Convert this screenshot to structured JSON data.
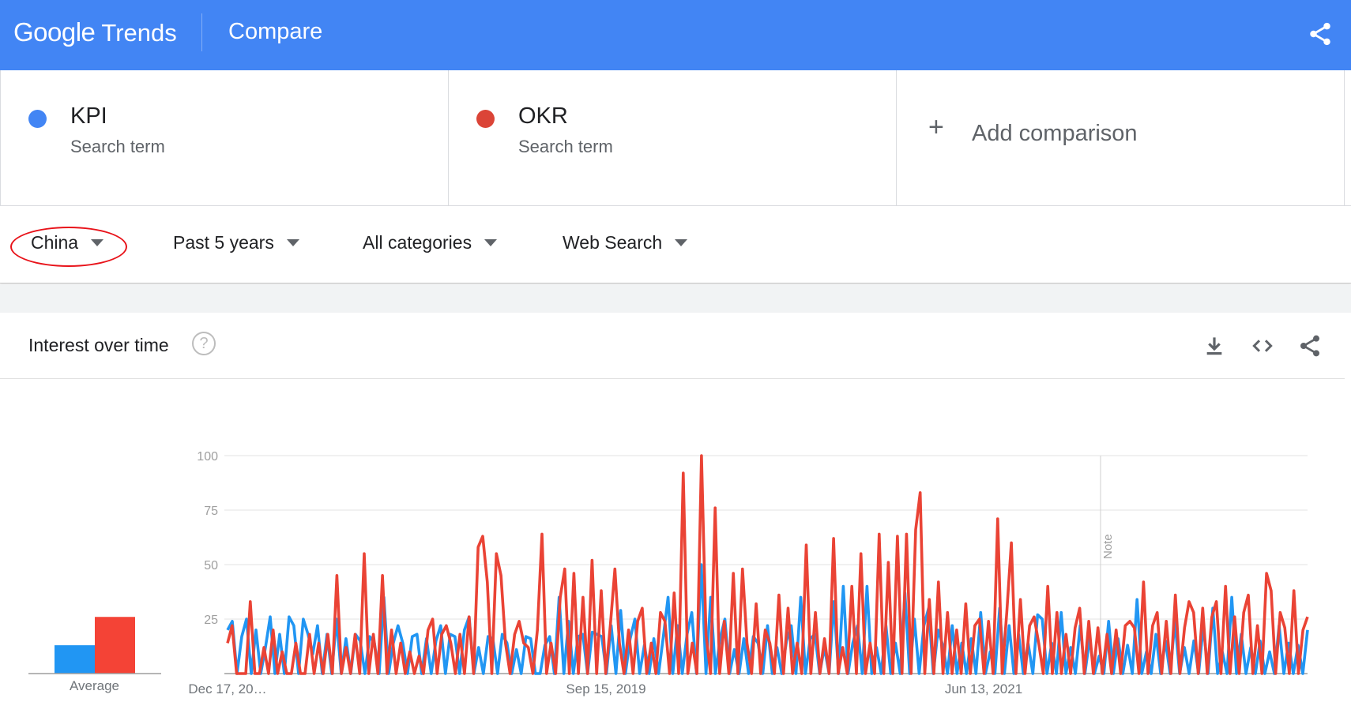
{
  "header": {
    "logo_google": "Google",
    "logo_trends": "Trends",
    "title": "Compare"
  },
  "compare": {
    "terms": [
      {
        "label": "KPI",
        "sub": "Search term",
        "color": "#4285f4"
      },
      {
        "label": "OKR",
        "sub": "Search term",
        "color": "#db4437"
      }
    ],
    "add_label": "Add comparison"
  },
  "filters": {
    "region": "China",
    "time": "Past 5 years",
    "category": "All categories",
    "search_type": "Web Search"
  },
  "widget": {
    "title": "Interest over time",
    "help": "?",
    "average_label": "Average",
    "note_label": "Note"
  },
  "chart_data": {
    "type": "line",
    "x_tick_labels": [
      "Dec 17, 20…",
      "Sep 15, 2019",
      "Jun 13, 2021"
    ],
    "ylim": [
      0,
      100
    ],
    "y_ticks": [
      25,
      50,
      75,
      100
    ],
    "grid": true,
    "averages": [
      {
        "series": "KPI",
        "value": 13
      },
      {
        "series": "OKR",
        "value": 26
      }
    ],
    "series": [
      {
        "name": "KPI",
        "color": "#2196f3",
        "values": [
          20,
          24,
          0,
          17,
          25,
          0,
          20,
          0,
          12,
          26,
          0,
          18,
          0,
          26,
          22,
          0,
          25,
          18,
          9,
          22,
          0,
          18,
          0,
          25,
          0,
          16,
          0,
          18,
          15,
          0,
          17,
          14,
          0,
          35,
          0,
          14,
          22,
          14,
          0,
          17,
          18,
          0,
          16,
          0,
          15,
          22,
          0,
          18,
          17,
          0,
          20,
          26,
          0,
          12,
          0,
          17,
          16,
          0,
          18,
          14,
          0,
          11,
          0,
          17,
          16,
          0,
          0,
          13,
          17,
          0,
          35,
          0,
          24,
          0,
          17,
          18,
          0,
          19,
          18,
          17,
          0,
          22,
          0,
          29,
          0,
          16,
          25,
          0,
          13,
          0,
          16,
          0,
          17,
          35,
          0,
          22,
          0,
          18,
          28,
          0,
          50,
          0,
          35,
          0,
          16,
          25,
          0,
          11,
          0,
          16,
          0,
          17,
          14,
          0,
          22,
          0,
          12,
          0,
          15,
          22,
          0,
          35,
          0,
          16,
          18,
          0,
          12,
          0,
          33,
          0,
          40,
          0,
          14,
          22,
          0,
          40,
          0,
          12,
          0,
          22,
          0,
          14,
          0,
          37,
          0,
          25,
          0,
          22,
          30,
          0,
          20,
          13,
          0,
          22,
          0,
          14,
          0,
          16,
          0,
          28,
          0,
          10,
          0,
          30,
          0,
          22,
          0,
          18,
          0,
          14,
          0,
          27,
          25,
          0,
          14,
          0,
          28,
          0,
          12,
          0,
          22,
          0,
          16,
          0,
          8,
          0,
          24,
          0,
          16,
          0,
          13,
          0,
          34,
          0,
          10,
          0,
          18,
          0,
          15,
          0,
          24,
          0,
          12,
          0,
          15,
          0,
          22,
          0,
          30,
          0,
          10,
          0,
          35,
          0,
          18,
          0,
          12,
          0,
          15,
          0,
          10,
          0,
          22,
          0,
          14,
          0,
          13,
          0,
          20
        ]
      },
      {
        "name": "OKR",
        "color": "#ea4335",
        "values": [
          14,
          22,
          0,
          0,
          0,
          33,
          0,
          0,
          12,
          0,
          20,
          0,
          10,
          0,
          0,
          14,
          0,
          0,
          18,
          0,
          14,
          0,
          18,
          0,
          45,
          0,
          12,
          0,
          18,
          0,
          55,
          0,
          18,
          0,
          45,
          0,
          20,
          0,
          14,
          0,
          10,
          0,
          8,
          0,
          20,
          25,
          0,
          18,
          22,
          14,
          0,
          18,
          0,
          26,
          0,
          58,
          63,
          42,
          0,
          55,
          45,
          14,
          0,
          18,
          24,
          14,
          12,
          0,
          20,
          64,
          0,
          14,
          0,
          35,
          48,
          0,
          46,
          0,
          35,
          0,
          52,
          0,
          38,
          0,
          22,
          48,
          14,
          0,
          20,
          0,
          24,
          30,
          0,
          14,
          0,
          28,
          24,
          0,
          37,
          0,
          92,
          0,
          14,
          0,
          100,
          18,
          0,
          76,
          0,
          24,
          0,
          46,
          0,
          48,
          14,
          0,
          32,
          0,
          20,
          14,
          0,
          36,
          0,
          30,
          0,
          14,
          0,
          59,
          0,
          28,
          0,
          16,
          0,
          62,
          0,
          12,
          0,
          40,
          0,
          55,
          0,
          14,
          0,
          64,
          0,
          51,
          0,
          63,
          0,
          64,
          0,
          66,
          83,
          0,
          34,
          0,
          42,
          0,
          28,
          0,
          20,
          0,
          32,
          0,
          22,
          25,
          0,
          24,
          0,
          71,
          0,
          28,
          60,
          0,
          34,
          0,
          22,
          26,
          14,
          0,
          40,
          0,
          28,
          0,
          18,
          0,
          21,
          30,
          0,
          24,
          0,
          21,
          0,
          18,
          0,
          20,
          0,
          22,
          24,
          21,
          0,
          42,
          0,
          22,
          28,
          0,
          24,
          0,
          36,
          0,
          21,
          33,
          28,
          0,
          30,
          0,
          26,
          33,
          0,
          40,
          0,
          26,
          0,
          28,
          36,
          0,
          22,
          0,
          46,
          38,
          0,
          28,
          21,
          0,
          38,
          0,
          20,
          26
        ]
      }
    ]
  }
}
